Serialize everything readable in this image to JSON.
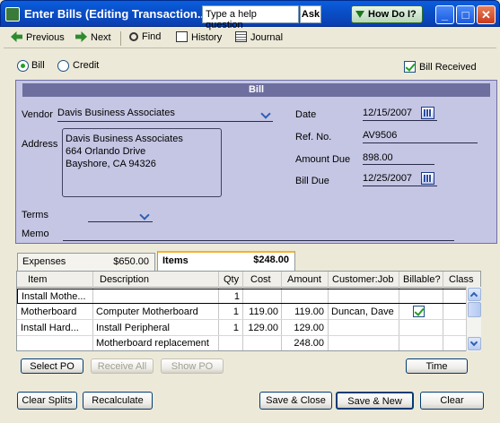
{
  "window": {
    "title": "Enter Bills (Editing Transaction...",
    "help_placeholder": "Type a help question",
    "ask_label": "Ask",
    "howdo_label": "How Do I?"
  },
  "toolbar": {
    "previous": "Previous",
    "next": "Next",
    "find": "Find",
    "history": "History",
    "journal": "Journal"
  },
  "type_options": {
    "bill": "Bill",
    "credit": "Credit",
    "selected": "bill"
  },
  "bill_received": {
    "label": "Bill Received",
    "checked": true
  },
  "bill": {
    "header": "Bill",
    "vendor_label": "Vendor",
    "vendor": "Davis Business Associates",
    "address_label": "Address",
    "address": [
      "Davis Business Associates",
      "664 Orlando Drive",
      "Bayshore, CA  94326"
    ],
    "terms_label": "Terms",
    "terms": "",
    "memo_label": "Memo",
    "memo": "",
    "date_label": "Date",
    "date": "12/15/2007",
    "refno_label": "Ref. No.",
    "refno": "AV9506",
    "amount_due_label": "Amount Due",
    "amount_due": "898.00",
    "bill_due_label": "Bill Due",
    "bill_due": "12/25/2007"
  },
  "tabs": {
    "expenses_label": "Expenses",
    "expenses_amount": "$650.00",
    "items_label": "Items",
    "items_amount": "$248.00"
  },
  "items_table": {
    "headers": [
      "Item",
      "Description",
      "Qty",
      "Cost",
      "Amount",
      "Customer:Job",
      "Billable?",
      "Class"
    ],
    "rows": [
      {
        "item": "Install Mothe...",
        "description": "",
        "qty": "1",
        "cost": "",
        "amount": "",
        "customer": "",
        "billable": false
      },
      {
        "item": "Motherboard",
        "description": "Computer Motherboard",
        "qty": "1",
        "cost": "119.00",
        "amount": "119.00",
        "customer": "Duncan, Dave",
        "billable": true
      },
      {
        "item": "Install Hard...",
        "description": "Install Peripheral",
        "qty": "1",
        "cost": "129.00",
        "amount": "129.00",
        "customer": "",
        "billable": false
      },
      {
        "item": "",
        "description": "Motherboard replacement",
        "qty": "",
        "cost": "",
        "amount": "248.00",
        "customer": "",
        "billable": false
      }
    ]
  },
  "buttons": {
    "select_po": "Select PO",
    "receive_all": "Receive All",
    "show_po": "Show PO",
    "time": "Time",
    "clear_splits": "Clear Splits",
    "recalculate": "Recalculate",
    "save_close": "Save & Close",
    "save_new": "Save & New",
    "clear": "Clear"
  }
}
